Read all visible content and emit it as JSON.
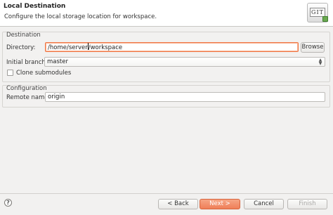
{
  "header": {
    "title": "Local Destination",
    "description": "Configure the local storage location for workspace.",
    "logo_text": "GIT"
  },
  "destination": {
    "group_label": "Destination",
    "directory_label": "Directory:",
    "directory_value_before_caret": "/home/server",
    "directory_value_after_caret": "/workspace",
    "browse_label": "Browse",
    "branch_label": "Initial branch:",
    "branch_value": "master",
    "clone_submodules_label": "Clone submodules",
    "clone_submodules_checked": false
  },
  "configuration": {
    "group_label": "Configuration",
    "remote_name_label": "Remote name:",
    "remote_name_value": "origin"
  },
  "footer": {
    "help_icon": "question-circle-icon",
    "back_label": "< Back",
    "next_label": "Next >",
    "cancel_label": "Cancel",
    "finish_label": "Finish"
  },
  "colors": {
    "accent": "#ef7f58",
    "focus_border": "#f07746"
  }
}
